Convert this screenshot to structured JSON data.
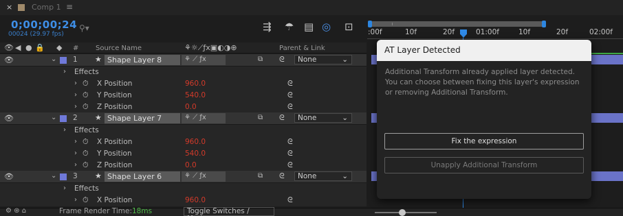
{
  "tab": {
    "close": "×",
    "label": "Comp 1",
    "menu": "≡"
  },
  "time": {
    "timecode": "0;00;00;24",
    "frame_info": "00024 (29.97 fps)"
  },
  "search": {
    "icon": "search-icon"
  },
  "ruler": {
    "labels": [
      ":00f",
      "10f",
      "20f",
      "01:00f",
      "10f",
      "20f",
      "02:00f"
    ]
  },
  "columns": {
    "number": "#",
    "source_name": "Source Name",
    "parent_link": "Parent & Link"
  },
  "layers": [
    {
      "number": "1",
      "name": "Shape Layer 8",
      "parent": "None",
      "effects_label": "Effects",
      "props": [
        {
          "name": "X Position",
          "value": "960.0"
        },
        {
          "name": "Y Position",
          "value": "540.0"
        },
        {
          "name": "Z Position",
          "value": "0.0"
        }
      ]
    },
    {
      "number": "2",
      "name": "Shape Layer 7",
      "parent": "None",
      "effects_label": "Effects",
      "props": [
        {
          "name": "X Position",
          "value": "960.0"
        },
        {
          "name": "Y Position",
          "value": "540.0"
        },
        {
          "name": "Z Position",
          "value": "0.0"
        }
      ]
    },
    {
      "number": "3",
      "name": "Shape Layer 6",
      "parent": "None",
      "effects_label": "Effects",
      "props": [
        {
          "name": "X Position",
          "value": "960.0"
        }
      ]
    }
  ],
  "bottom": {
    "frame_render_label": "Frame Render Time:",
    "frame_render_value": "18ms",
    "toggle_label": "Toggle Switches / Modes"
  },
  "dialog": {
    "title": "AT Layer Detected",
    "body": "Additional Transform already applied layer detected. You can choose between fixing this layer's expression or removing Additional Transform.",
    "fix_button": "Fix the expression",
    "unapply_button": "Unapply Additional Transform"
  },
  "colors": {
    "timecode": "#3e8ee6",
    "label_swatch": "#6f79d9",
    "value_red": "#d33a2a",
    "render_time_green": "#4fb848",
    "playhead": "#2f8ae8"
  }
}
